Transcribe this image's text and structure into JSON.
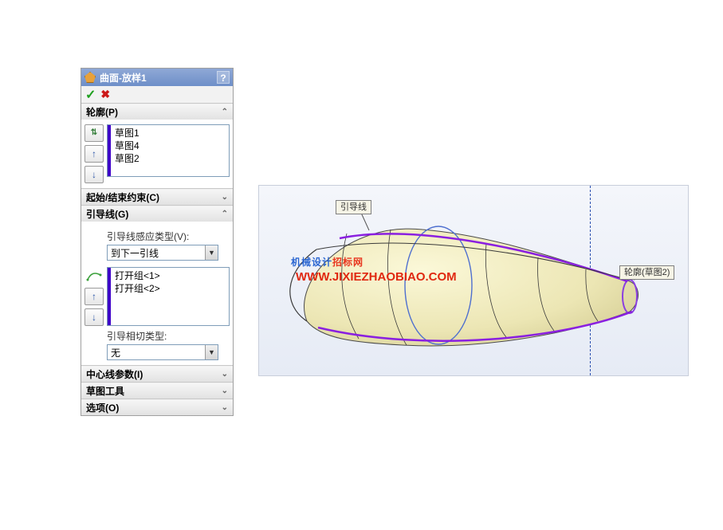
{
  "panel": {
    "title": "曲面-放样1",
    "help": "?",
    "sections": {
      "profiles": {
        "header": "轮廓(P)",
        "items": [
          "草图1",
          "草图4",
          "草图2"
        ]
      },
      "constraints": {
        "header": "起始/结束约束(C)"
      },
      "guides": {
        "header": "引导线(G)",
        "sensing_label": "引导线感应类型(V):",
        "sensing_value": "到下一引线",
        "items": [
          "打开组<1>",
          "打开组<2>"
        ],
        "tangent_label": "引导相切类型:",
        "tangent_value": "无"
      },
      "centerline": {
        "header": "中心线参数(I)"
      },
      "sketchtools": {
        "header": "草图工具"
      },
      "options": {
        "header": "选项(O)"
      }
    }
  },
  "viewport": {
    "callout_guide": "引导线",
    "callout_profile": "轮廓(草图2)",
    "watermark_cn_a": "机械设计",
    "watermark_cn_b": "招标网",
    "watermark_url": "WWW.JIXIEZHAOBIAO.COM"
  }
}
